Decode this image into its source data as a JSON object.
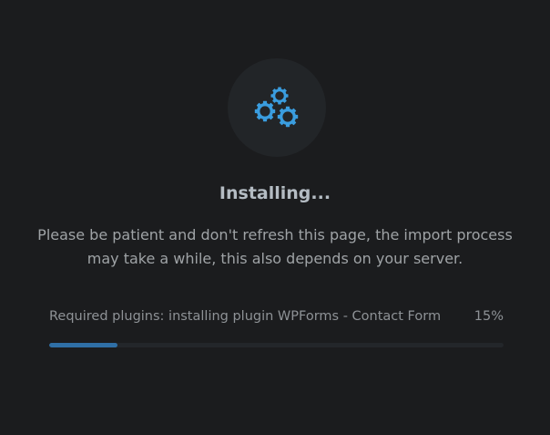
{
  "installer": {
    "icon": "gears-icon",
    "accent_color": "#3a9ddf",
    "title": "Installing...",
    "description_line1": "Please be patient and don't refresh this page, the import process",
    "description_line2": "may take a while, this also depends on your server.",
    "status_text": "Required plugins: installing plugin WPForms - Contact Form",
    "progress_label": "15%",
    "progress_fraction": 0.15,
    "progress_color": "#2f6fa6"
  }
}
